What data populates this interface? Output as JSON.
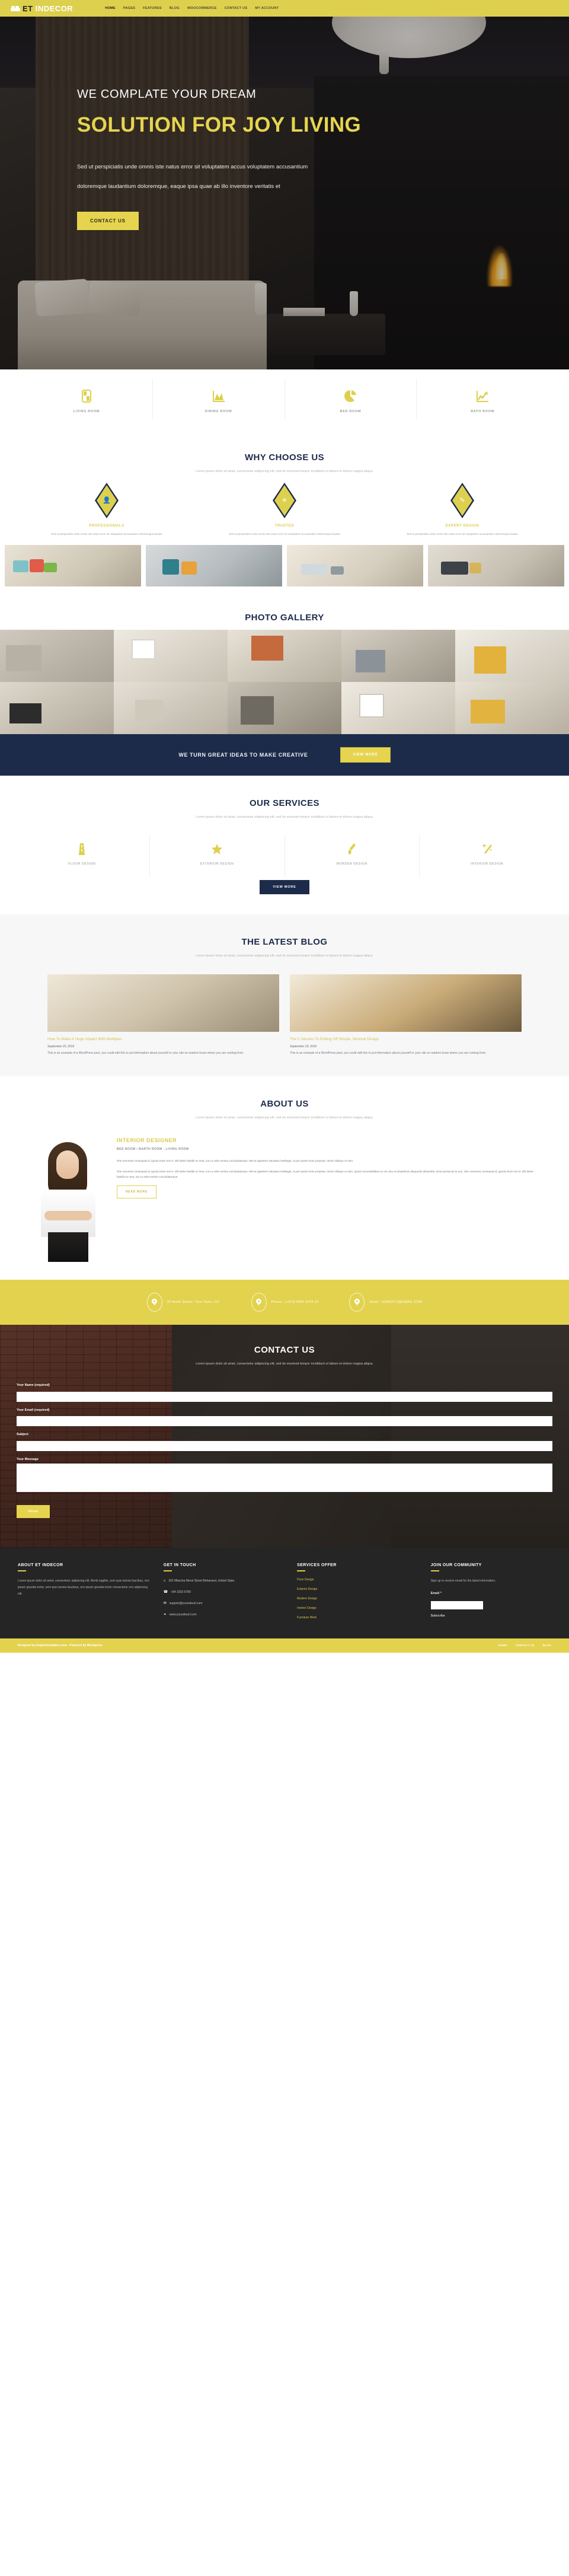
{
  "brand": {
    "et": "ET",
    "indecor": "INDECOR",
    "icon": "bed-icon"
  },
  "nav": [
    {
      "label": "HOME",
      "active": true
    },
    {
      "label": "PAGES",
      "active": false
    },
    {
      "label": "FEATURES",
      "active": false
    },
    {
      "label": "BLOG",
      "active": false
    },
    {
      "label": "WOOCOMMERCE",
      "active": false
    },
    {
      "label": "CONTACT US",
      "active": false
    },
    {
      "label": "MY ACCOUNT",
      "active": false
    }
  ],
  "hero": {
    "subtitle": "WE COMPLATE YOUR DREAM",
    "title": "SOLUTION FOR JOY LIVING",
    "paragraph": "Sed ut perspiciatis unde omnis iste natus error sit voluptatem accus voluptatem accusantium doloremque laudantium doloremque, eaque ipsa quae ab illo inventore veritatis et",
    "button": "CONTACT US"
  },
  "categories": [
    {
      "label": "LIVING ROOM",
      "icon": "grid-chart-icon"
    },
    {
      "label": "DINING ROOM",
      "icon": "area-chart-icon"
    },
    {
      "label": "BED ROOM",
      "icon": "pie-chart-icon"
    },
    {
      "label": "BATH ROOM",
      "icon": "line-chart-icon"
    }
  ],
  "why": {
    "title": "WHY CHOOSE US",
    "desc": "Lorem ipsum dolor sit amet, consectetur adipiscing elit, sed do eiusmod tempor incididunt ut labore et dolore magna aliqua.",
    "items": [
      {
        "title": "PROFESSIONALS",
        "icon": "user-icon",
        "glyph": "♟",
        "text": "Sed ut perspiciatis unde omnis iste natus error sit voluptatem accusantium doloremque laudan"
      },
      {
        "title": "TRUSTED",
        "icon": "badge-icon",
        "glyph": "✳",
        "text": "Sed ut perspiciatis unde omnis iste natus error sit voluptatem accusantium doloremque laudan"
      },
      {
        "title": "EXPERT DESIGN",
        "icon": "edit-icon",
        "glyph": "✎",
        "text": "Sed ut perspiciatis unde omnis iste natus error sit voluptatem accusantium doloremque laudan"
      }
    ]
  },
  "gallery": {
    "title": "PHOTO GALLERY"
  },
  "cta": {
    "text": "WE TURN GREAT IDEAS TO MAKE CREATIVE",
    "button": "VIEW MORE"
  },
  "services": {
    "title": "OUR SERVICES",
    "desc": "Lorem ipsum dolor sit amet, consectetur adipiscing elit, sed do eiusmod tempor incididunt ut labore et dolore magna aliqua.",
    "items": [
      {
        "label": "FLOOR DESIGN",
        "icon": "road-icon",
        "glyph": "⛿"
      },
      {
        "label": "EXTERIOR DESIGN",
        "icon": "star-icon",
        "glyph": "★"
      },
      {
        "label": "MORDEN DESIGN",
        "icon": "paintbrush-icon",
        "glyph": "✐"
      },
      {
        "label": "INTERIOR DESIGN",
        "icon": "magic-wand-icon",
        "glyph": "✦"
      }
    ],
    "button": "VIEW MORE"
  },
  "blog": {
    "title": "THE LATEST BLOG",
    "desc": "Lorem ipsum dolor sit amet, consectetur adipiscing elit, sed do eiusmod tempor incididunt ut labore et dolore magna aliqua.",
    "posts": [
      {
        "title": "How To Make A Huge Impact With Multiples",
        "date": "September 23, 2016",
        "excerpt": "This is an example of a WordPress post, you could edit this to put information about yourself or your site so readers know where you are coming from."
      },
      {
        "title": "The 5 Secrets To Pulling Off Simple, Minimal Design",
        "date": "September 23, 2016",
        "excerpt": "This is an example of a WordPress post, you could edit this to put information about yourself or your site so readers know where you are coming from."
      }
    ]
  },
  "about": {
    "title": "ABOUT US",
    "desc": "Lorem ipsum dolor sit amet, consectetur adipiscing elit, sed do eiusmod tempor incididunt ut labore et dolore magna aliqua.",
    "role": "INTERIOR DESIGNER",
    "tags": "BED ROOM / BARTH ROOM - LIVING ROOM",
    "p1": "She nonumes consequat id, ignota iriure mei in. Elit latine fastidii ex mea, ius cu solet veritus concludaturque. Mel at appetere salutatus intellegat, ut per posse iriure propriae, minim oblique ut nam.",
    "p2": "She nonumes consequat id, ignota iriure mei in. Elit latine fastidii ex mea, ius cu solet veritus concludaturque. Mel at appetere salutatus intellegat, ut per posse iriure propriae, minim oblique ut nam. Quem necessitatibus eu sit, duo ne phaedrum aliquando dissentiet, simul persecuti te usu. She nonumes consequat id, ignota iriure mei in. Elit latine fastidii ex mea, ius cu solet veritus concludaturque.",
    "button": "READ MORE"
  },
  "infobar": [
    {
      "icon": "location-pin-icon",
      "text": "25 North Street / Your Town, CO."
    },
    {
      "icon": "location-pin-icon",
      "text": "Phone : (+314) 0454 3234 23"
    },
    {
      "icon": "location-pin-icon",
      "text": "Email : NOREPLY@GMAIL.COM"
    }
  ],
  "contact": {
    "title": "CONTACT US",
    "desc": "Lorem ipsum dolor sit amet, consectetur adipiscing elit, sed do eiusmod tempor incididunt ut labore et dolore magna aliqua.",
    "fields": [
      {
        "label": "Your Name (required)",
        "value": "",
        "placeholder": ""
      },
      {
        "label": "Your Email (required)",
        "value": "",
        "placeholder": ""
      },
      {
        "label": "Subject",
        "value": "",
        "placeholder": ""
      }
    ],
    "message_label": "Your Message",
    "message_value": "",
    "send_button": "Send"
  },
  "footer": {
    "about": {
      "title": "ABOUT ET INDECOR",
      "text": "Lorem ipsum dolor sit amet, consectetur adipiscing elit. Morbi sagittis, sem quis lacinia faucibus, orci ipsum gravida tortor, sem quis lacinia faucibus, orci ipsum gravida tortor consectetur orci adipiscing elit."
    },
    "touch": {
      "title": "GET IN TOUCH",
      "items": [
        {
          "icon": "home-icon",
          "glyph": "⌂",
          "text": "262 Milacina Mrest Street Behansed, United State."
        },
        {
          "icon": "phone-icon",
          "glyph": "☎",
          "text": "+84 3333 6789"
        },
        {
          "icon": "envelope-icon",
          "glyph": "✉",
          "text": "support@yoursiteurl.com"
        },
        {
          "icon": "globe-icon",
          "glyph": "◍",
          "text": "www.yoursiteurl.com"
        }
      ]
    },
    "services": {
      "title": "SERVICES OFFER",
      "links": [
        "Floor Design",
        "Exterior Design",
        "Modern Design",
        "Interior Design",
        "Furniture Work"
      ]
    },
    "community": {
      "title": "JOIN OUR COMMUNITY",
      "text": "Sign up to receive email for the latest information.",
      "email_label": "Email *",
      "email_value": "",
      "subscribe": "Subscribe"
    },
    "credit": "Designed by Enginetemplates.com - Powered by Wordpress",
    "links": [
      "HOME",
      "CONTACT US",
      "BLOG"
    ]
  },
  "colors": {
    "accent": "#e3d24e",
    "navy": "#1d2b4a",
    "dark": "#252525"
  }
}
